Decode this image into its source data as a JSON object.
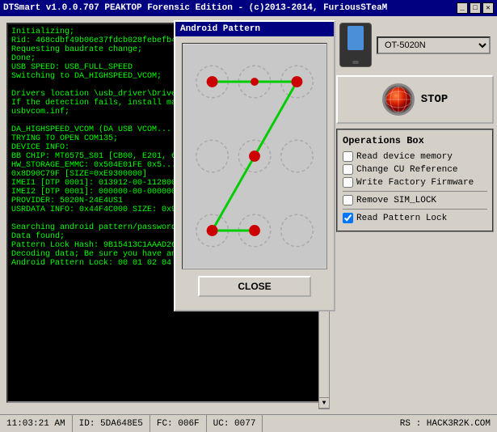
{
  "titlebar": {
    "title": "DTSmart v1.0.0.707 PEAKTOP Forensic Edition - (c)2013-2014, FuriousSTeaM",
    "minimize": "_",
    "maximize": "□",
    "close": "✕"
  },
  "log": {
    "content": "Initializing;\nRid: 468cdbf49b06e37fdcb028febefb409b\nRequesting baudrate change;\nDone;\nUSB SPEED: USB_FULL_SPEED\nSwitching to DA_HIGHSPEED_VCOM;\n\nDrivers location \\usb_driver\\Driver_Auto_...\nIf the detection fails, install manually the po...\nusbvcom.inf;\n\nDA_HIGHSPEED_VCOM (DA USB VCOM...\nTRYING TO OPEN COM135;\nDEVICE INFO:\nBB CHIP: MT6575_S01 [CB00, E201, 6575...\nHW_STORAGE_EMMC: 0x504E01FE 0x5...\n0x8D90C79F [SIZE=0xE9300000]\nIMEI1 [DTP 0001]: 013912-00-112800-9\nIMEI2 [DTP 0001]: 000000-00-000000-0\nPROVIDER: 5020N-24E4US1\nUSRDATA INFO: 0x44F4C000 SIZE: 0x9E...\n\nSearching android pattern/password/pin lo...\nData found;\nPattern Lock Hash: 9B15413C1AAAD264C...\nDecoding data; Be sure you have an worki...\nAndroid Pattern Lock: 00 01 02 04 07 08"
  },
  "device": {
    "model": "OT-5020N"
  },
  "stop_button": {
    "label": "STOP"
  },
  "operations": {
    "title": "Operations Box",
    "items": [
      {
        "label": "Read device memory",
        "checked": false
      },
      {
        "label": "Change CU Reference",
        "checked": false
      },
      {
        "label": "Write Factory Firmware",
        "checked": false
      },
      {
        "label": "Remove SIM_LOCK",
        "checked": false
      },
      {
        "label": "Read Pattern Lock",
        "checked": true
      }
    ]
  },
  "pattern_dialog": {
    "title": "Android Pattern",
    "close_label": "CLOSE"
  },
  "status_bar": {
    "time": "11:03:21 AM",
    "id": "ID: 5DA648E5",
    "fc": "FC: 006F",
    "uc": "UC: 0077",
    "rs": "RS : HACK3R2K.COM"
  }
}
